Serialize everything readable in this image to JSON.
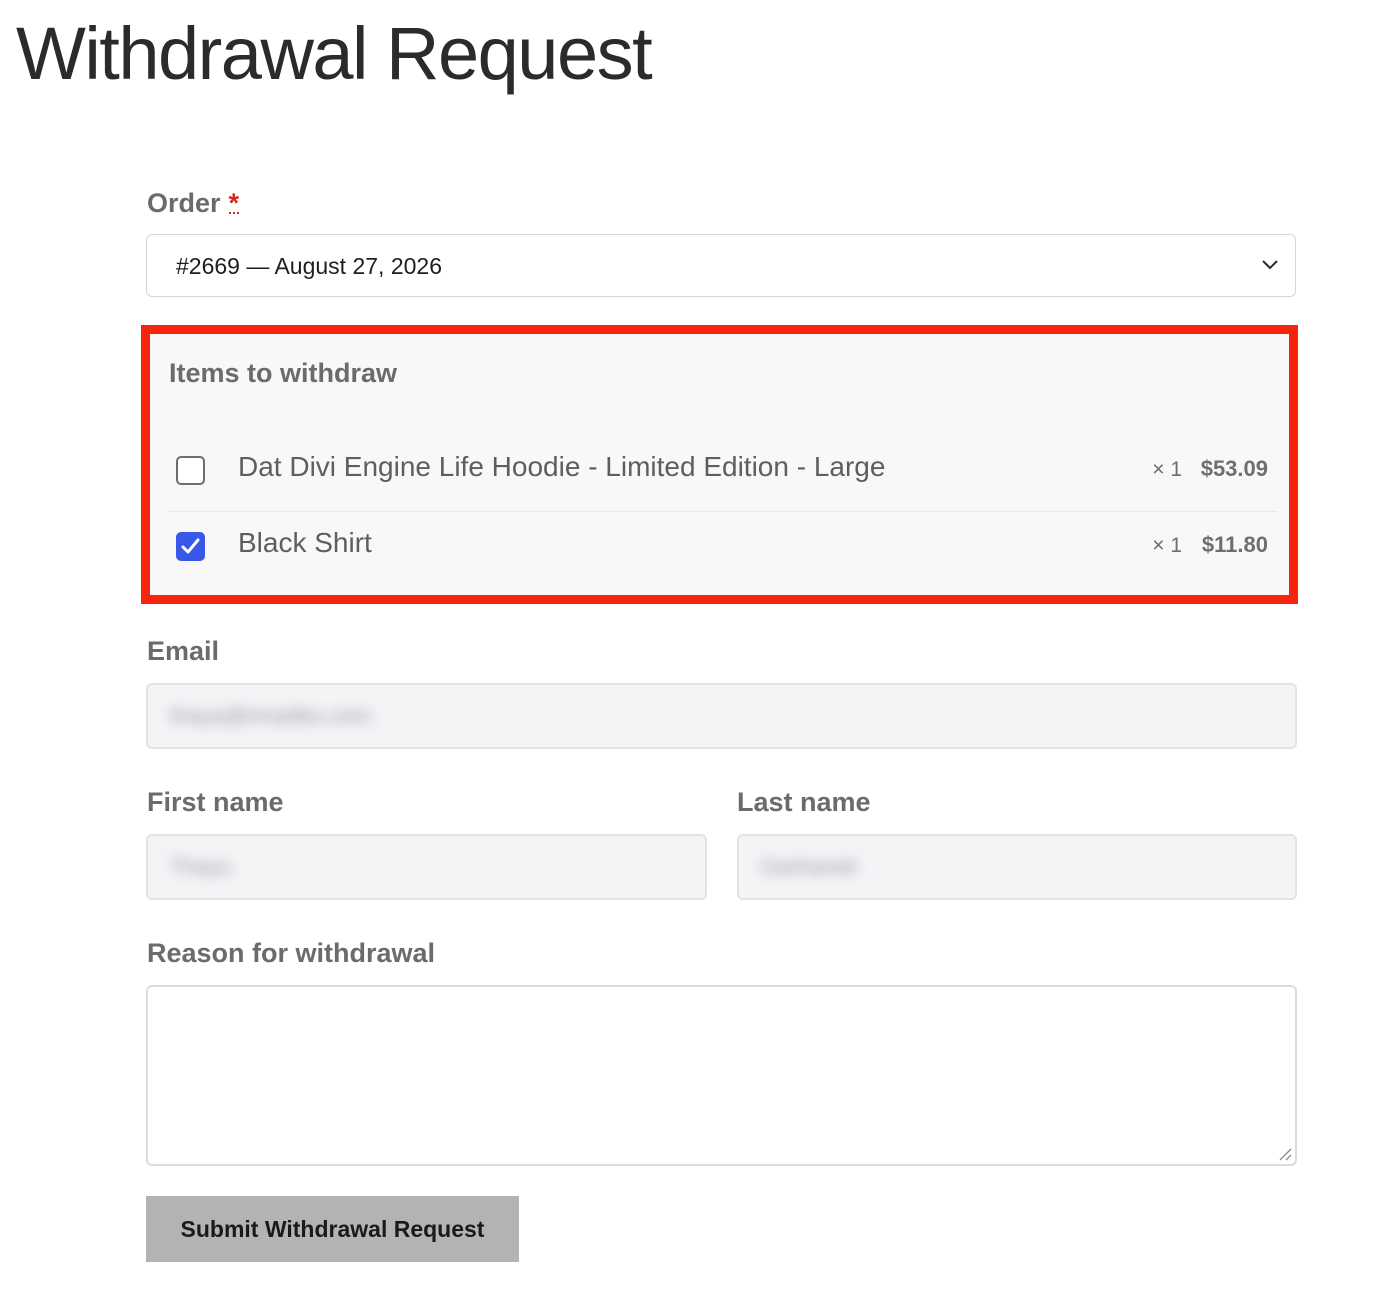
{
  "page": {
    "title": "Withdrawal Request"
  },
  "order": {
    "label": "Order",
    "required_mark": "*",
    "selected": "#2669 — August 27, 2026"
  },
  "items_section": {
    "title": "Items to withdraw",
    "items": [
      {
        "name": "Dat Divi Engine Life Hoodie - Limited Edition - Large",
        "qty": "× 1",
        "price": "$53.09",
        "checked": false
      },
      {
        "name": "Black Shirt",
        "qty": "× 1",
        "price": "$11.80",
        "checked": true
      }
    ]
  },
  "email": {
    "label": "Email",
    "value": "thaya@inradiko.com"
  },
  "first_name": {
    "label": "First name",
    "value": "Thayu"
  },
  "last_name": {
    "label": "Last name",
    "value": "Garhanek"
  },
  "reason": {
    "label": "Reason for withdrawal",
    "value": ""
  },
  "submit": {
    "label": "Submit Withdrawal Request"
  },
  "colors": {
    "highlight_border": "#f5250c",
    "checkbox_checked": "#3858e9",
    "required": "#d9261c",
    "button_bg": "#b3b3b3"
  },
  "icons": {
    "select_arrow": "chevron-down-icon",
    "checkmark": "checkmark-icon",
    "resize": "resize-handle-icon"
  }
}
